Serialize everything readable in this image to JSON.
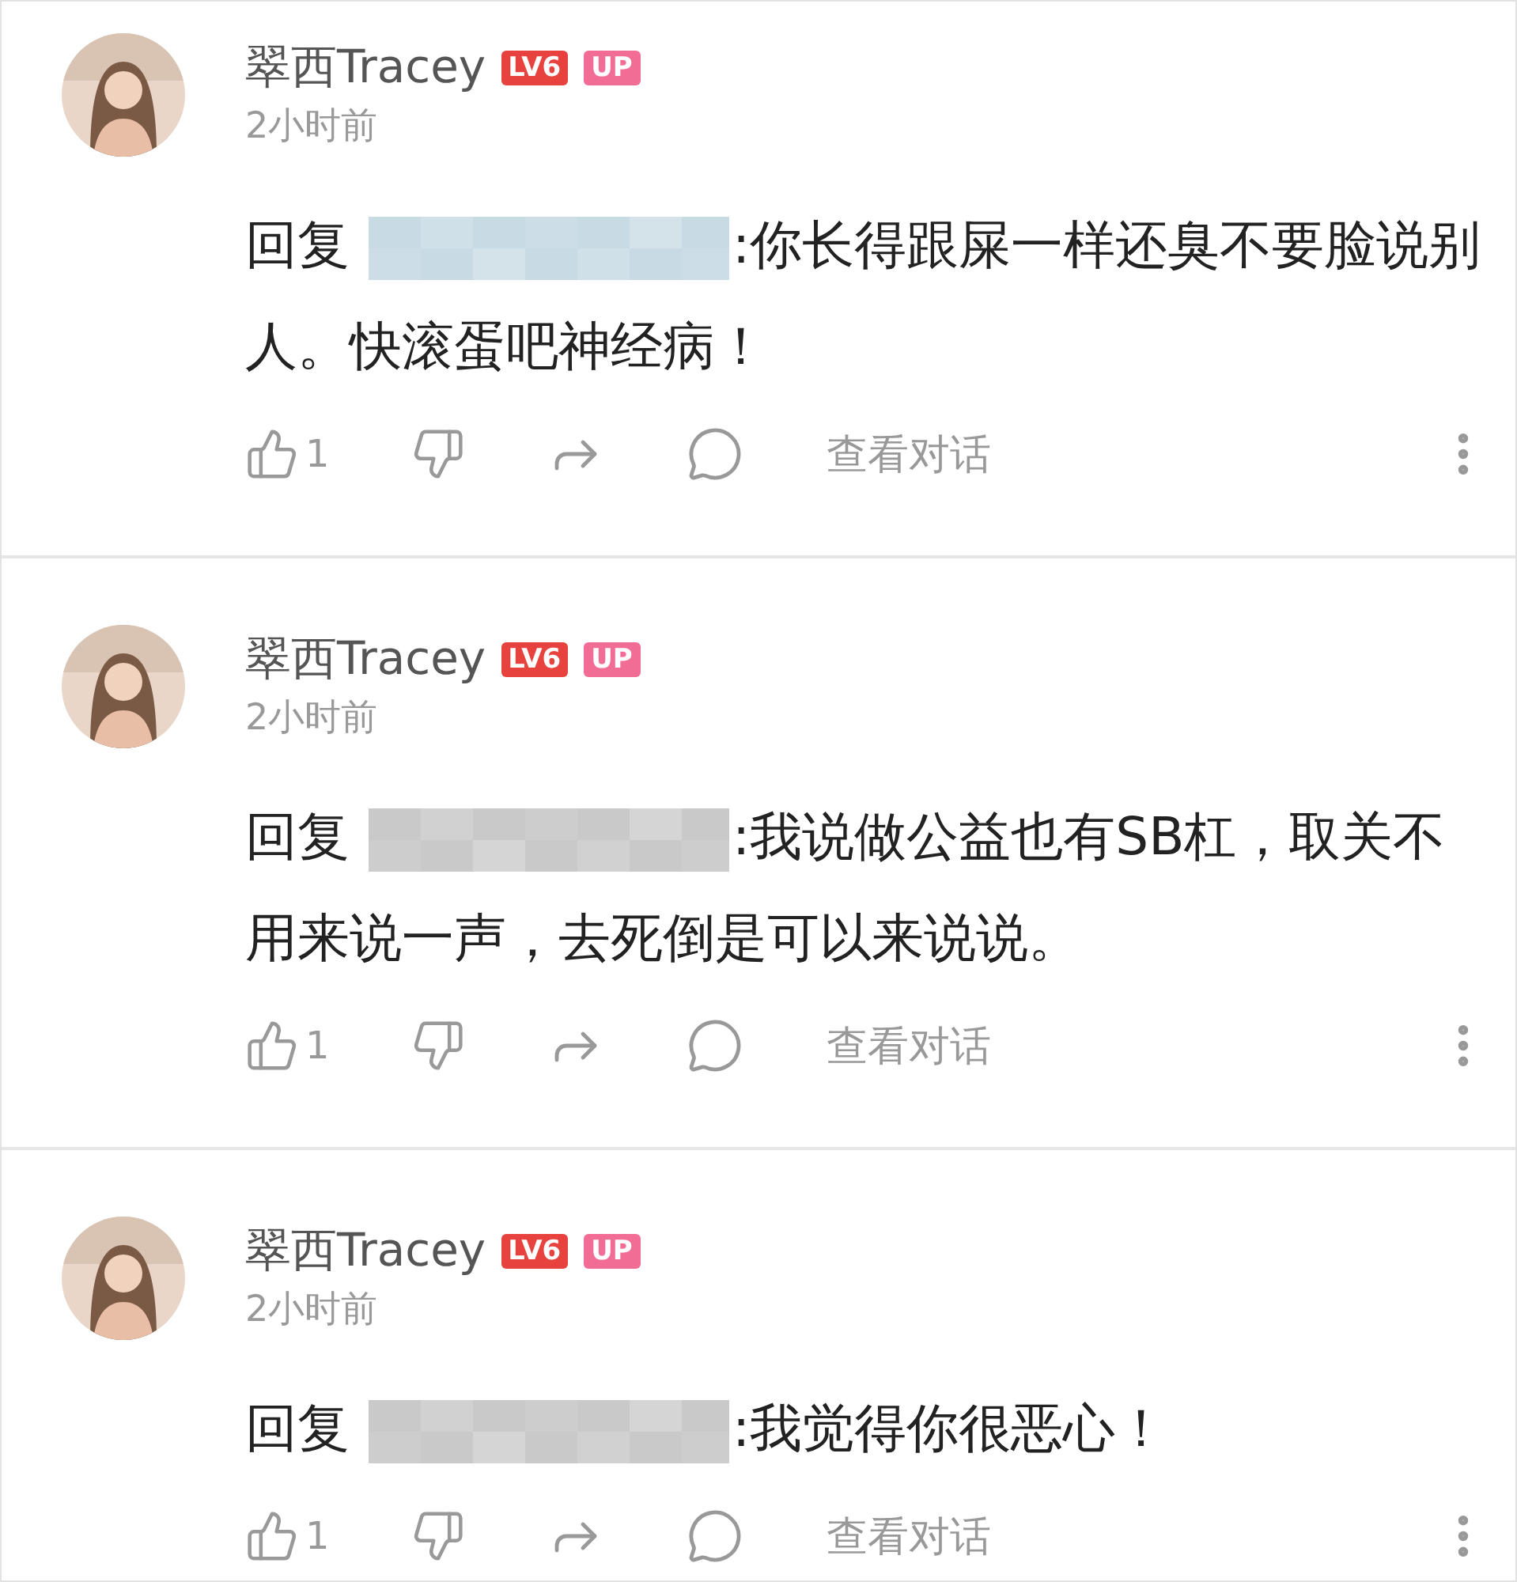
{
  "comments": [
    {
      "author": "翠西Tracey",
      "level_badge": "LV6",
      "up_badge": "UP",
      "time": "2小时前",
      "reply_prefix": "回复",
      "redaction": {
        "color": "#c8dbe5"
      },
      "text": ":你长得跟屎一样还臭不要脸说别人。快滚蛋吧神经病！",
      "likes": "1",
      "view_conversation": "查看对话"
    },
    {
      "author": "翠西Tracey",
      "level_badge": "LV6",
      "up_badge": "UP",
      "time": "2小时前",
      "reply_prefix": "回复",
      "redaction": {
        "color": "#c9c9c9"
      },
      "text": ":我说做公益也有SB杠，取关不用来说一声，去死倒是可以来说说。",
      "likes": "1",
      "view_conversation": "查看对话"
    },
    {
      "author": "翠西Tracey",
      "level_badge": "LV6",
      "up_badge": "UP",
      "time": "2小时前",
      "reply_prefix": "回复",
      "redaction": {
        "color": "#c9c9c9"
      },
      "text": ":我觉得你很恶心！",
      "likes": "1",
      "view_conversation": "查看对话"
    }
  ]
}
